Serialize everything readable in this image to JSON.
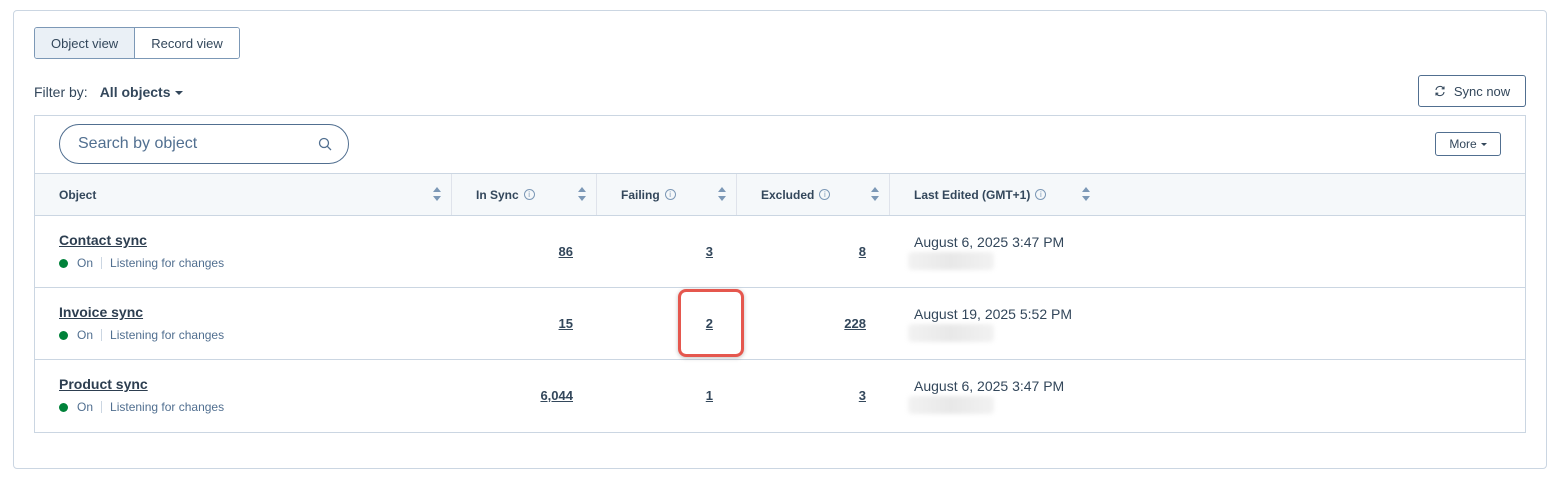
{
  "view_toggle": {
    "object_view": "Object view",
    "record_view": "Record view"
  },
  "filter": {
    "label": "Filter by:",
    "value": "All objects"
  },
  "sync_button": "Sync now",
  "search": {
    "placeholder": "Search by object"
  },
  "more_button": "More",
  "columns": {
    "object": "Object",
    "in_sync": "In Sync",
    "failing": "Failing",
    "excluded": "Excluded",
    "last_edited": "Last Edited (GMT+1)"
  },
  "rows": [
    {
      "name": "Contact sync",
      "status": "On",
      "status_detail": "Listening for changes",
      "in_sync": "86",
      "failing": "3",
      "excluded": "8",
      "last_edited": "August 6, 2025 3:47 PM"
    },
    {
      "name": "Invoice sync",
      "status": "On",
      "status_detail": "Listening for changes",
      "in_sync": "15",
      "failing": "2",
      "excluded": "228",
      "last_edited": "August 19, 2025 5:52 PM"
    },
    {
      "name": "Product sync",
      "status": "On",
      "status_detail": "Listening for changes",
      "in_sync": "6,044",
      "failing": "1",
      "excluded": "3",
      "last_edited": "August 6, 2025 3:47 PM"
    }
  ],
  "colors": {
    "status_on": "#00823a",
    "highlight": "#e5574e"
  }
}
